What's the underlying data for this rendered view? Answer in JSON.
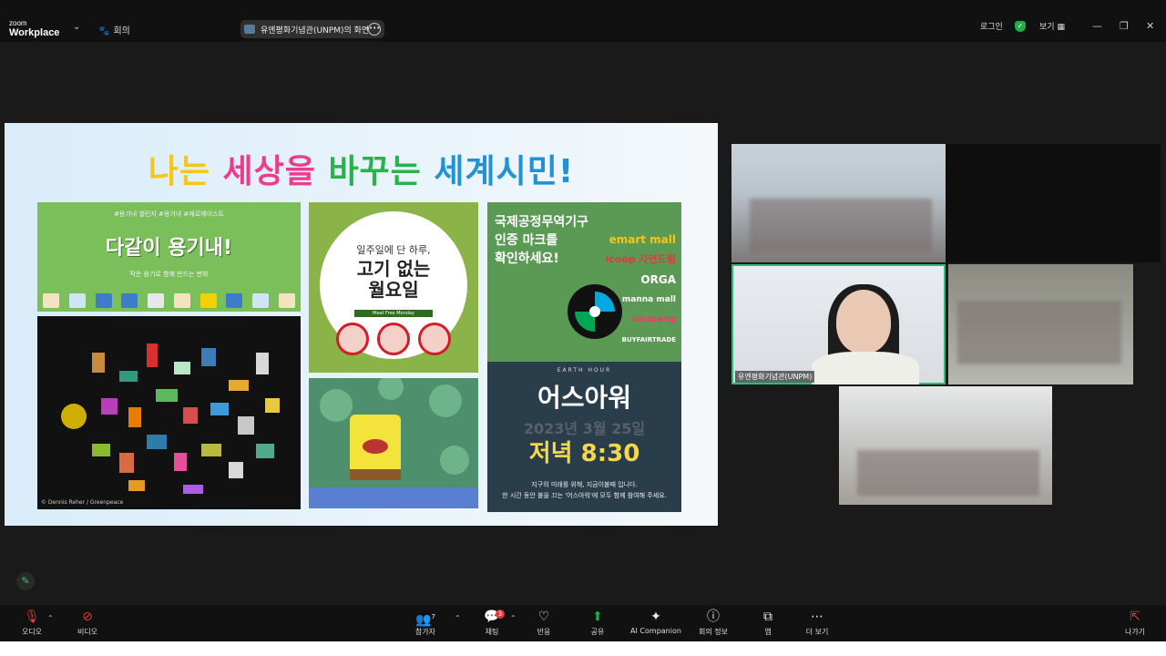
{
  "app": {
    "brand_top": "zoom",
    "brand_main": "Workplace"
  },
  "topbar": {
    "meeting_label": "회의",
    "share_pill": "유엔평화기념관(UNPM)의 화면",
    "login": "로그인",
    "view": "보기"
  },
  "slide": {
    "title_parts": [
      "나는",
      "세상을",
      "바꾸는",
      "세계시민!"
    ],
    "panel_reuse": {
      "tags": "#용기내 챌린지 #용기내 #제로웨이스트",
      "headline": "다같이 용기내!",
      "sub": "작은 용기로 함께 만드는 변화"
    },
    "photo_credit": "© Dennis Reher / Greenpeace",
    "meat_free": {
      "line1": "일주일에 단 하루,",
      "line2": "고기 없는",
      "line3": "월요일",
      "label": "Meat Free Monday"
    },
    "fairtrade": {
      "text_l1": "국제공정무역기구",
      "text_l2": "인증 마크를",
      "text_l3": "확인하세요!",
      "brand1": "emart mall",
      "brand2": "icoop 자연드림",
      "brand3": "ORGA",
      "brand4": "manna mall",
      "brand5": "coupang",
      "brand6": "BUYFAIRTRADE"
    },
    "earth_hour": {
      "header": "EARTH HOUR",
      "title": "어스아워",
      "date": "2023년 3월 25일",
      "time": "저녁 8:30",
      "sub1": "지구의 미래를 위해, 지금이불때 입니다.",
      "sub2": "한 시간 동안 불을 끄는 '어스아워'에 모두 함께 참여해 주세요."
    }
  },
  "video": {
    "speaker_name": "유엔평화기념관(UNPM)"
  },
  "toolbar": {
    "audio": "오디오",
    "video": "비디오",
    "participants": "참가자",
    "participants_count": "7",
    "chat": "채팅",
    "chat_badge": "3",
    "reactions": "반응",
    "share": "공유",
    "ai": "AI Companion",
    "info": "회의 정보",
    "apps": "앱",
    "more": "더 보기",
    "leave": "나가기"
  },
  "colors": {
    "accent_green": "#27c07a",
    "share_green": "#1fae4a",
    "leave_red": "#e53935"
  }
}
